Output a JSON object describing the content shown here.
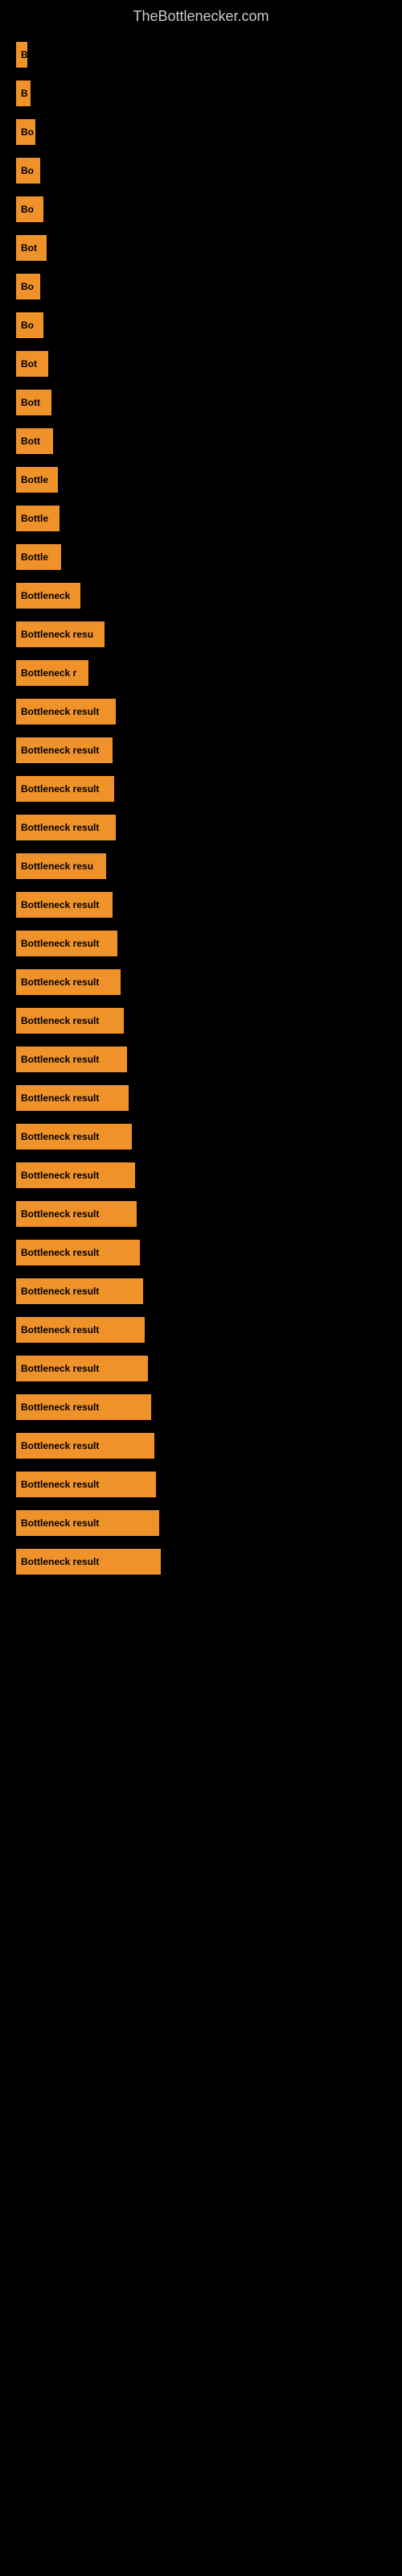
{
  "header": {
    "title": "TheBottlenecker.com"
  },
  "bars": [
    {
      "label": "B",
      "width": 14
    },
    {
      "label": "B",
      "width": 18
    },
    {
      "label": "Bo",
      "width": 24
    },
    {
      "label": "Bo",
      "width": 30
    },
    {
      "label": "Bo",
      "width": 34
    },
    {
      "label": "Bot",
      "width": 38
    },
    {
      "label": "Bo",
      "width": 30
    },
    {
      "label": "Bo",
      "width": 34
    },
    {
      "label": "Bot",
      "width": 40
    },
    {
      "label": "Bott",
      "width": 44
    },
    {
      "label": "Bott",
      "width": 46
    },
    {
      "label": "Bottle",
      "width": 52
    },
    {
      "label": "Bottle",
      "width": 54
    },
    {
      "label": "Bottle",
      "width": 56
    },
    {
      "label": "Bottleneck",
      "width": 80
    },
    {
      "label": "Bottleneck resu",
      "width": 110
    },
    {
      "label": "Bottleneck r",
      "width": 90
    },
    {
      "label": "Bottleneck result",
      "width": 124
    },
    {
      "label": "Bottleneck result",
      "width": 120
    },
    {
      "label": "Bottleneck result",
      "width": 122
    },
    {
      "label": "Bottleneck result",
      "width": 124
    },
    {
      "label": "Bottleneck resu",
      "width": 112
    },
    {
      "label": "Bottleneck result",
      "width": 120
    },
    {
      "label": "Bottleneck result",
      "width": 126
    },
    {
      "label": "Bottleneck result",
      "width": 130
    },
    {
      "label": "Bottleneck result",
      "width": 134
    },
    {
      "label": "Bottleneck result",
      "width": 138
    },
    {
      "label": "Bottleneck result",
      "width": 140
    },
    {
      "label": "Bottleneck result",
      "width": 144
    },
    {
      "label": "Bottleneck result",
      "width": 148
    },
    {
      "label": "Bottleneck result",
      "width": 150
    },
    {
      "label": "Bottleneck result",
      "width": 154
    },
    {
      "label": "Bottleneck result",
      "width": 158
    },
    {
      "label": "Bottleneck result",
      "width": 160
    },
    {
      "label": "Bottleneck result",
      "width": 164
    },
    {
      "label": "Bottleneck result",
      "width": 168
    },
    {
      "label": "Bottleneck result",
      "width": 172
    },
    {
      "label": "Bottleneck result",
      "width": 174
    },
    {
      "label": "Bottleneck result",
      "width": 178
    },
    {
      "label": "Bottleneck result",
      "width": 180
    }
  ]
}
